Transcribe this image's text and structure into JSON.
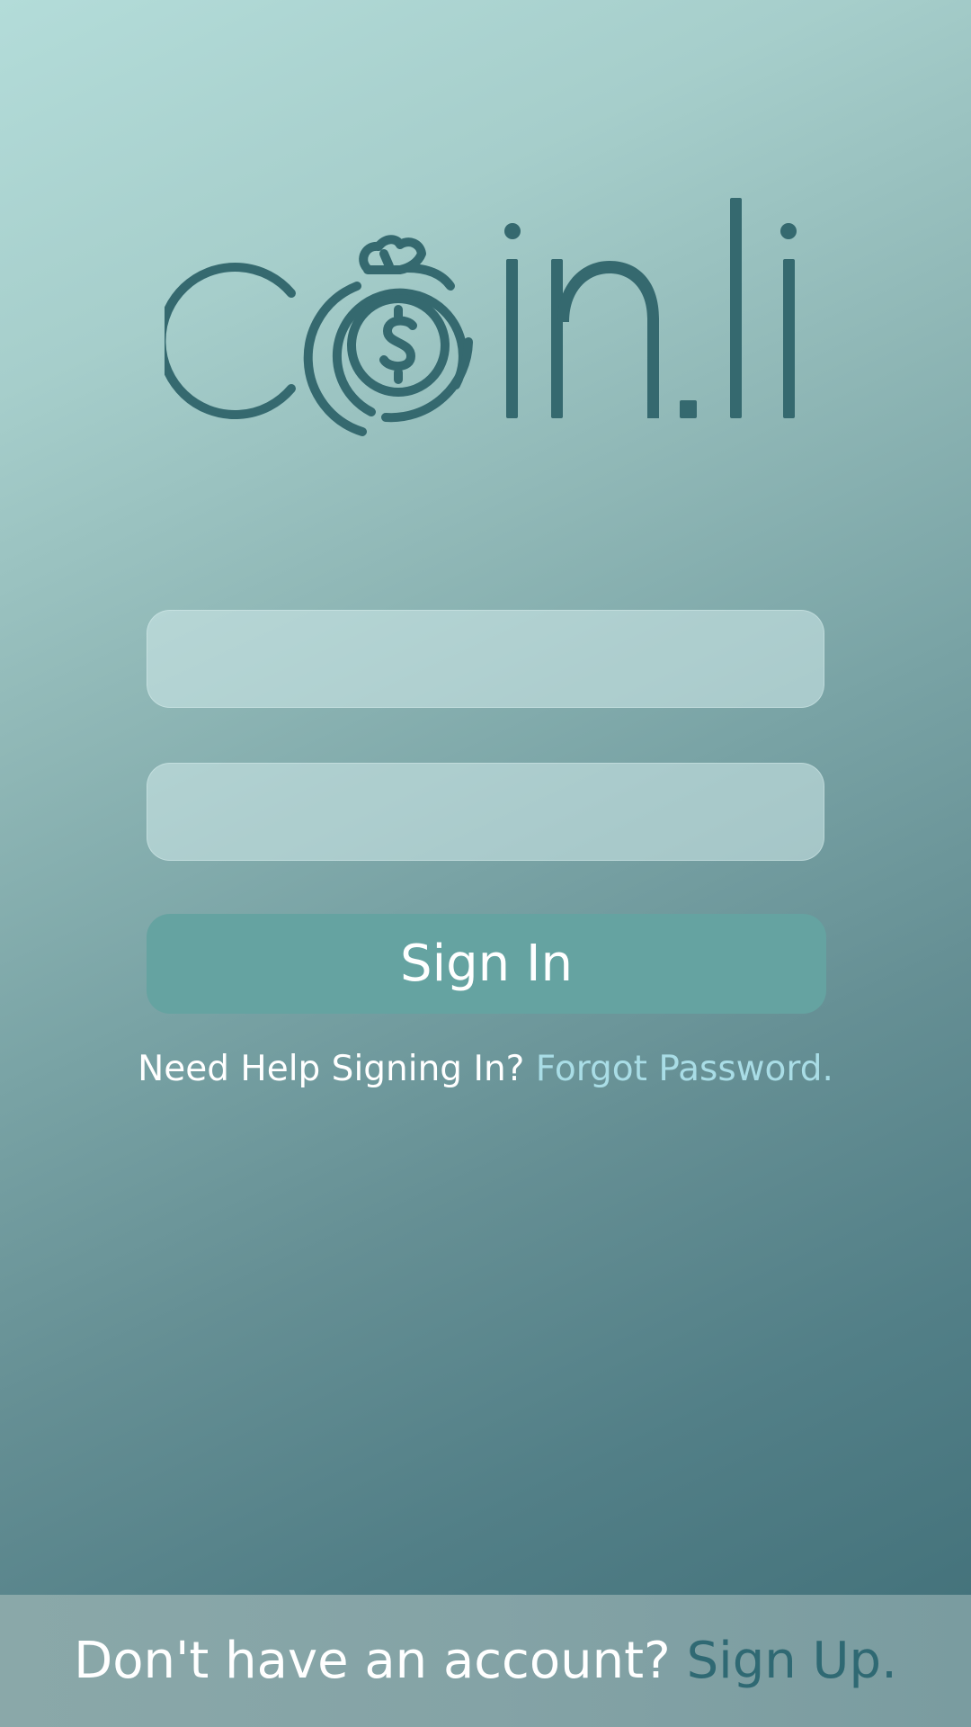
{
  "app": {
    "logo_text": "coin.li",
    "logo_color": "#35696f"
  },
  "login": {
    "username_placeholder": "",
    "password_placeholder": "",
    "signin_label": "Sign In"
  },
  "help": {
    "prompt": "Need Help Signing In?",
    "link": "Forgot Password."
  },
  "footer": {
    "prompt": "Don't have an account?",
    "link": "Sign Up."
  },
  "colors": {
    "button": "#65a3a1",
    "link_light": "#a9dde6",
    "link_dark": "#2f6973"
  }
}
